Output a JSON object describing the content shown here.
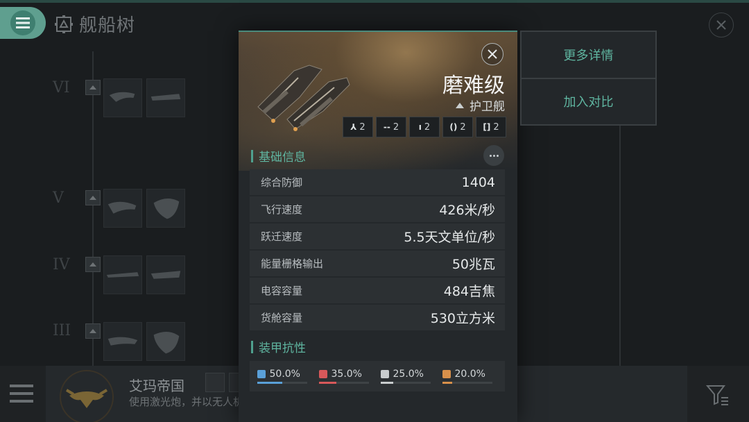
{
  "header": {
    "title": "舰船树",
    "menu_icon": "hamburger-icon",
    "title_icon": "ship-tree-icon",
    "close_icon": "close-icon"
  },
  "tiers": [
    "VI",
    "V",
    "IV",
    "III"
  ],
  "detail": {
    "ship_name": "磨难级",
    "ship_class": "护卫舰",
    "slots": [
      {
        "icon": "turret-icon",
        "glyph": "⅄",
        "count": "2"
      },
      {
        "icon": "launcher-icon",
        "glyph": "--",
        "count": "2"
      },
      {
        "icon": "drone-icon",
        "glyph": "ı",
        "count": "2"
      },
      {
        "icon": "rig-icon",
        "glyph": "()",
        "count": "2"
      },
      {
        "icon": "subsystem-icon",
        "glyph": "[]",
        "count": "2"
      }
    ],
    "section_basic": "基础信息",
    "section_armor": "装甲抗性",
    "stats": [
      {
        "label": "综合防御",
        "value": "1404"
      },
      {
        "label": "飞行速度",
        "value": "426米/秒"
      },
      {
        "label": "跃迁速度",
        "value": "5.5天文单位/秒"
      },
      {
        "label": "能量栅格输出",
        "value": "50兆瓦"
      },
      {
        "label": "电容容量",
        "value": "484吉焦"
      },
      {
        "label": "货舱容量",
        "value": "530立方米"
      }
    ],
    "resists": [
      {
        "icon": "em-resist-icon",
        "value": "50.0%",
        "fraction": 0.5,
        "color": "#5aa0d8"
      },
      {
        "icon": "thermal-resist-icon",
        "value": "35.0%",
        "fraction": 0.35,
        "color": "#d8585a"
      },
      {
        "icon": "kinetic-resist-icon",
        "value": "25.0%",
        "fraction": 0.25,
        "color": "#c8ccce"
      },
      {
        "icon": "explosive-resist-icon",
        "value": "20.0%",
        "fraction": 0.2,
        "color": "#d8904a"
      }
    ]
  },
  "side_menu": {
    "more_details": "更多详情",
    "add_compare": "加入对比"
  },
  "faction": {
    "name": "艾玛帝国",
    "description": "使用激光炮，并以无人机作为辅助手段。对装甲的重视程度优于速度。"
  },
  "colors": {
    "accent": "#5fb5a0",
    "panel": "#24282b",
    "row": "#2c3033"
  }
}
